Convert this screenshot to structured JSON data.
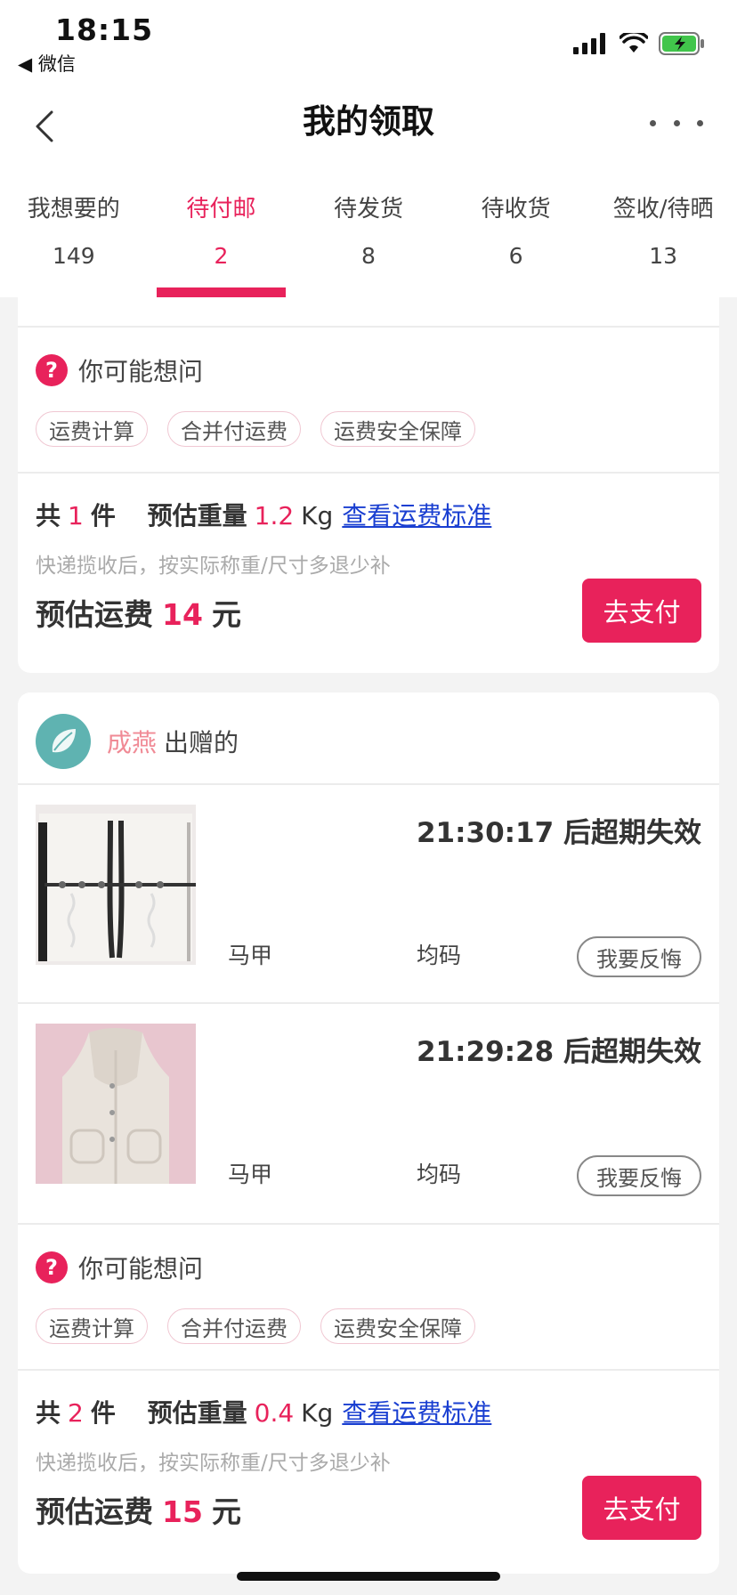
{
  "status": {
    "time": "18:15",
    "back_app": "◀ 微信"
  },
  "nav": {
    "title": "我的领取"
  },
  "tabs": [
    {
      "label": "我想要的",
      "count": "149"
    },
    {
      "label": "待付邮",
      "count": "2",
      "active": true
    },
    {
      "label": "待发货",
      "count": "8"
    },
    {
      "label": "待收货",
      "count": "6"
    },
    {
      "label": "签收/待晒",
      "count": "13"
    }
  ],
  "faq": {
    "title": "你可能想问",
    "chips": [
      "运费计算",
      "合并付运费",
      "运费安全保障"
    ]
  },
  "order1": {
    "total_prefix": "共",
    "count": "1",
    "count_unit": "件",
    "weight_label": "预估重量",
    "weight": "1.2",
    "weight_unit": "Kg",
    "link": "查看运费标准",
    "note": "快递揽收后，按实际称重/尺寸多退少补",
    "fee_label": "预估运费",
    "fee": "14",
    "fee_unit": "元",
    "pay_label": "去支付"
  },
  "order2": {
    "donor_name": "成燕",
    "donor_suffix": "出赠的",
    "items": [
      {
        "expire": "21:30:17 后超期失效",
        "name": "马甲",
        "size": "均码",
        "action": "我要反悔"
      },
      {
        "expire": "21:29:28 后超期失效",
        "name": "马甲",
        "size": "均码",
        "action": "我要反悔"
      }
    ],
    "total_prefix": "共",
    "count": "2",
    "count_unit": "件",
    "weight_label": "预估重量",
    "weight": "0.4",
    "weight_unit": "Kg",
    "link": "查看运费标准",
    "note": "快递揽收后，按实际称重/尺寸多退少补",
    "fee_label": "预估运费",
    "fee": "15",
    "fee_unit": "元",
    "pay_label": "去支付"
  },
  "colors": {
    "accent": "#e8225b",
    "link": "#1a3fd1",
    "donor": "#f08a95",
    "avatar": "#5fb3b1"
  }
}
